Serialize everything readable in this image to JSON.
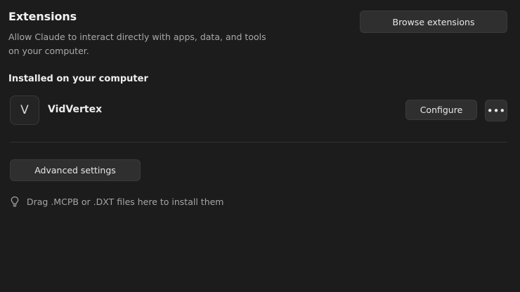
{
  "header": {
    "title": "Extensions",
    "description": "Allow Claude to interact directly with apps, data, and tools on your computer.",
    "browse_label": "Browse extensions"
  },
  "installed": {
    "section_title": "Installed on your computer",
    "extensions": [
      {
        "initial": "V",
        "name": "VidVertex",
        "configure_label": "Configure",
        "more_label": "•••"
      }
    ]
  },
  "advanced": {
    "label": "Advanced settings"
  },
  "hint": {
    "icon": "lightbulb-icon",
    "text": "Drag .MCPB or .DXT files here to install them"
  }
}
